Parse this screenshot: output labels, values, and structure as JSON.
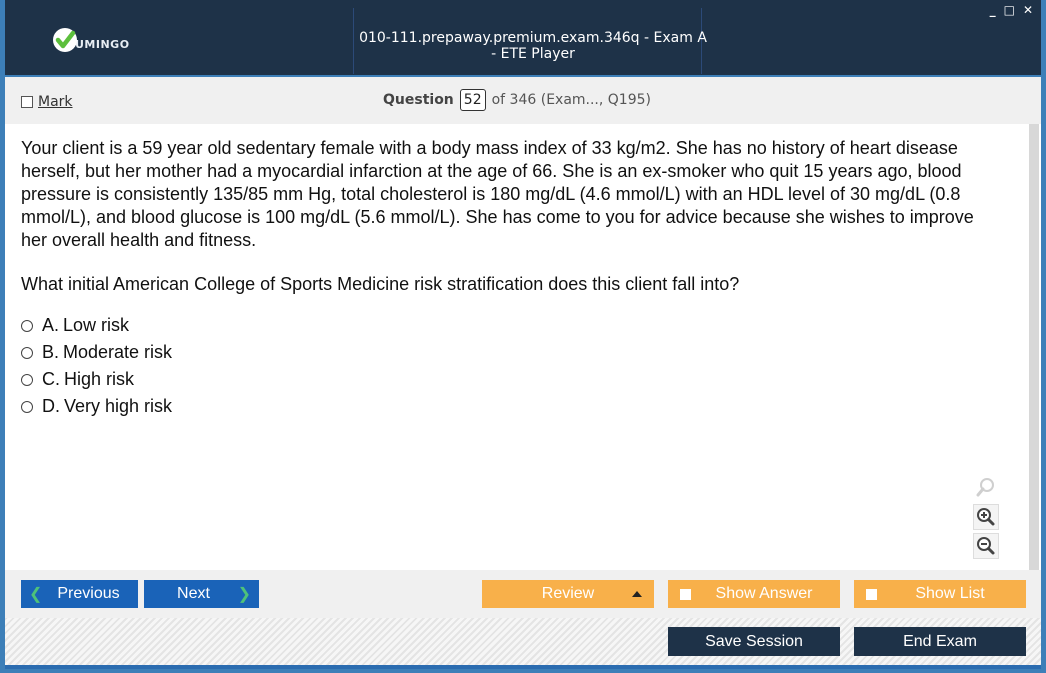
{
  "app": {
    "title": "010-111.prepaway.premium.exam.346q - Exam A - ETE Player",
    "logo_text": "UMINGO",
    "window_controls": {
      "minimize": "_",
      "maximize": "□",
      "close": "✕"
    }
  },
  "header": {
    "mark_label": "Mark",
    "question_label": "Question",
    "question_number": "52",
    "question_total": "of 346 (Exam..., Q195)"
  },
  "question": {
    "scenario": "Your client is a 59 year old sedentary female with a body mass index of 33 kg/m2. She has no history of heart disease herself, but her mother had a myocardial infarction at the age of 66. She is an ex-smoker who quit 15 years ago, blood pressure is consistently 135/85 mm Hg, total cholesterol is 180 mg/dL (4.6 mmol/L) with an HDL level of 30 mg/dL (0.8 mmol/L), and blood glucose is 100 mg/dL (5.6 mmol/L). She has come to you for advice because she wishes to improve her overall health and fitness.",
    "prompt": "What initial American College of Sports Medicine risk stratification does this client fall into?",
    "options": [
      {
        "letter": "A.",
        "text": "Low risk"
      },
      {
        "letter": "B.",
        "text": "Moderate risk"
      },
      {
        "letter": "C.",
        "text": "High risk"
      },
      {
        "letter": "D.",
        "text": "Very high risk"
      }
    ]
  },
  "nav": {
    "previous_label": "Previous",
    "next_label": "Next",
    "review_label": "Review",
    "show_answer_label": "Show Answer",
    "show_list_label": "Show List",
    "save_session_label": "Save Session",
    "end_exam_label": "End Exam"
  },
  "colors": {
    "titlebar": "#1e3248",
    "nav_blue": "#1a63b8",
    "orange": "#f8b04a",
    "arrow_green": "#4ec27a",
    "logo_green": "#5cbf3c"
  }
}
